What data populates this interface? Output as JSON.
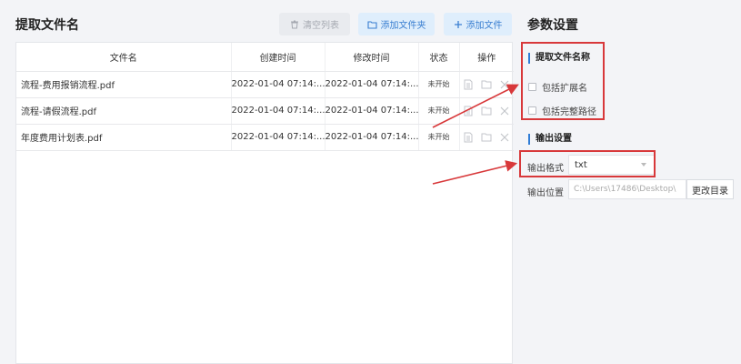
{
  "header": {
    "title": "提取文件名",
    "clear_label": "清空列表",
    "add_folder_label": "添加文件夹",
    "add_file_label": "添加文件"
  },
  "table": {
    "columns": [
      "文件名",
      "创建时间",
      "修改时间",
      "状态",
      "操作"
    ],
    "rows": [
      {
        "name": "流程-费用报销流程.pdf",
        "created": "2022-01-04 07:14:...",
        "modified": "2022-01-04 07:14:...",
        "status": "未开始"
      },
      {
        "name": "流程-请假流程.pdf",
        "created": "2022-01-04 07:14:...",
        "modified": "2022-01-04 07:14:...",
        "status": "未开始"
      },
      {
        "name": "年度费用计划表.pdf",
        "created": "2022-01-04 07:14:...",
        "modified": "2022-01-04 07:14:...",
        "status": "未开始"
      }
    ]
  },
  "settings": {
    "title": "参数设置",
    "extract_section": "提取文件名称",
    "include_ext_label": "包括扩展名",
    "include_path_label": "包括完整路径",
    "output_section": "输出设置",
    "format_label": "输出格式",
    "format_value": "txt",
    "location_label": "输出位置",
    "location_value": "C:\\Users\\17486\\Desktop\\",
    "change_dir_label": "更改目录"
  },
  "colors": {
    "accent": "#2f7cd6",
    "highlight": "#d8383a"
  }
}
